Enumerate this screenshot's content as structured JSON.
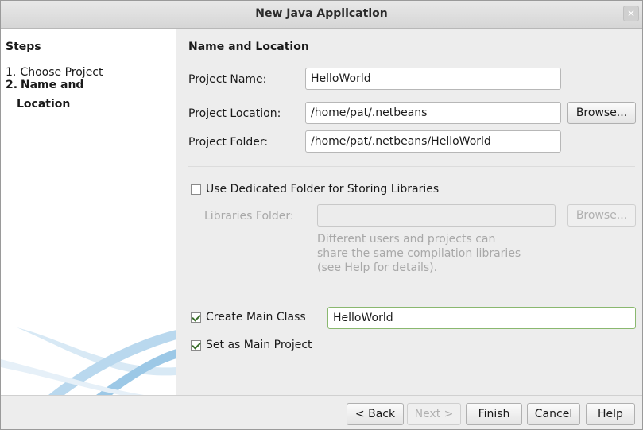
{
  "window": {
    "title": "New Java Application"
  },
  "steps": {
    "title": "Steps",
    "items": [
      {
        "num": "1.",
        "label": "Choose Project"
      },
      {
        "num": "2.",
        "label": "Name and",
        "label2": "Location"
      }
    ]
  },
  "panel": {
    "title": "Name and Location"
  },
  "project_name": {
    "label": "Project Name:",
    "value": "HelloWorld"
  },
  "project_location": {
    "label": "Project Location:",
    "value": "/home/pat/.netbeans",
    "browse": "Browse..."
  },
  "project_folder": {
    "label": "Project Folder:",
    "value": "/home/pat/.netbeans/HelloWorld"
  },
  "dedicated_folder": {
    "label": "Use Dedicated Folder for Storing Libraries",
    "checked": false
  },
  "libraries_folder": {
    "label": "Libraries Folder:",
    "value": "",
    "browse": "Browse..."
  },
  "libraries_help": "Different users and projects can\nshare the same compilation libraries\n(see Help for details).",
  "main_class": {
    "label": "Create Main Class",
    "value": "HelloWorld",
    "checked": true
  },
  "main_project": {
    "label": "Set as Main Project",
    "checked": true
  },
  "buttons": {
    "back": "< Back",
    "next": "Next >",
    "finish": "Finish",
    "cancel": "Cancel",
    "help": "Help"
  },
  "colors": {
    "check_green": "#3a6f2b",
    "decor_blue": "#9cc8e6"
  }
}
